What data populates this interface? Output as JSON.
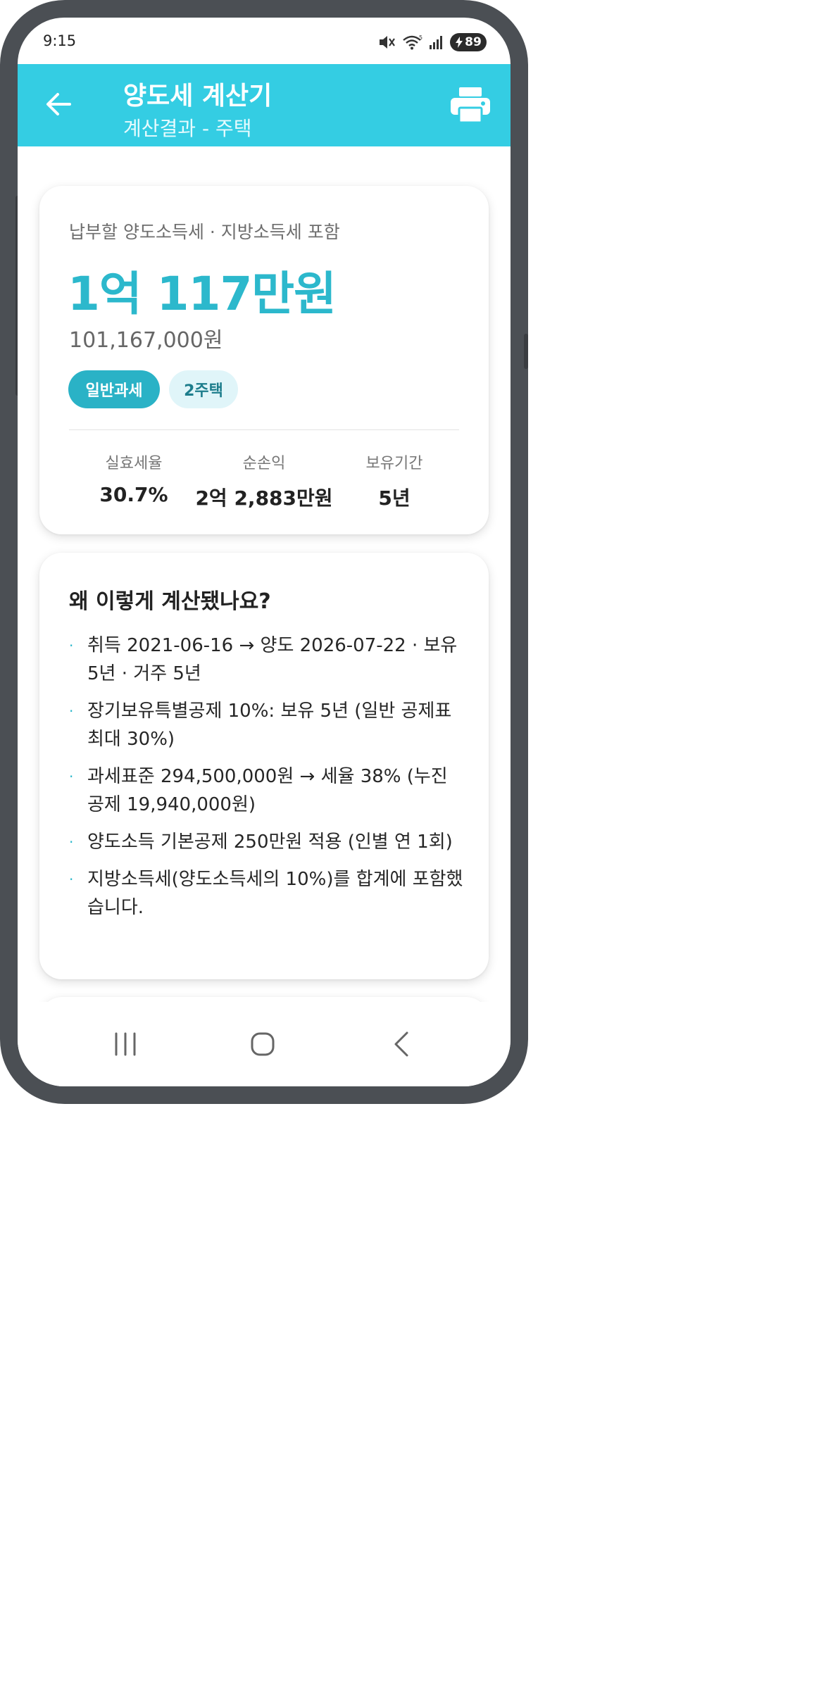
{
  "status_bar": {
    "time": "9:15",
    "icons": [
      "mute-icon",
      "wifi-icon",
      "signal-icon"
    ],
    "battery": "89",
    "battery_icon": "charging-bolt-icon"
  },
  "appbar": {
    "title": "양도세 계산기",
    "subtitle": "계산결과 - 주택",
    "back_icon": "arrow-left-icon",
    "print_icon": "printer-icon",
    "background": "#34cde3"
  },
  "result": {
    "label": "납부할 양도소득세 · 지방소득세 포함",
    "amount": "1억 117만원",
    "amount_full": "101,167,000원",
    "chips": [
      "일반과세",
      "2주택"
    ],
    "stats": [
      {
        "label": "실효세율",
        "value": "30.7%"
      },
      {
        "label": "순손익",
        "value": "2억 2,883만원"
      },
      {
        "label": "보유기간",
        "value": "5년"
      }
    ],
    "accent": "#2cb8cc"
  },
  "explanation": {
    "title": "왜 이렇게 계산됐나요?",
    "bullet": "·",
    "items": [
      "취득 2021-06-16 → 양도 2026-07-22 · 보유 5년 · 거주 5년",
      "장기보유특별공제 10%: 보유 5년 (일반 공제표 최대 30%)",
      "과세표준 294,500,000원 → 세율 38% (누진공제 19,940,000원)",
      "양도소득 기본공제 250만원 적용 (인별 연 1회)",
      "지방소득세(양도소득세의 10%)를 합계에 포함했습니다."
    ]
  },
  "navbar": {
    "icons": [
      "recent-apps-icon",
      "home-icon",
      "back-icon"
    ]
  }
}
